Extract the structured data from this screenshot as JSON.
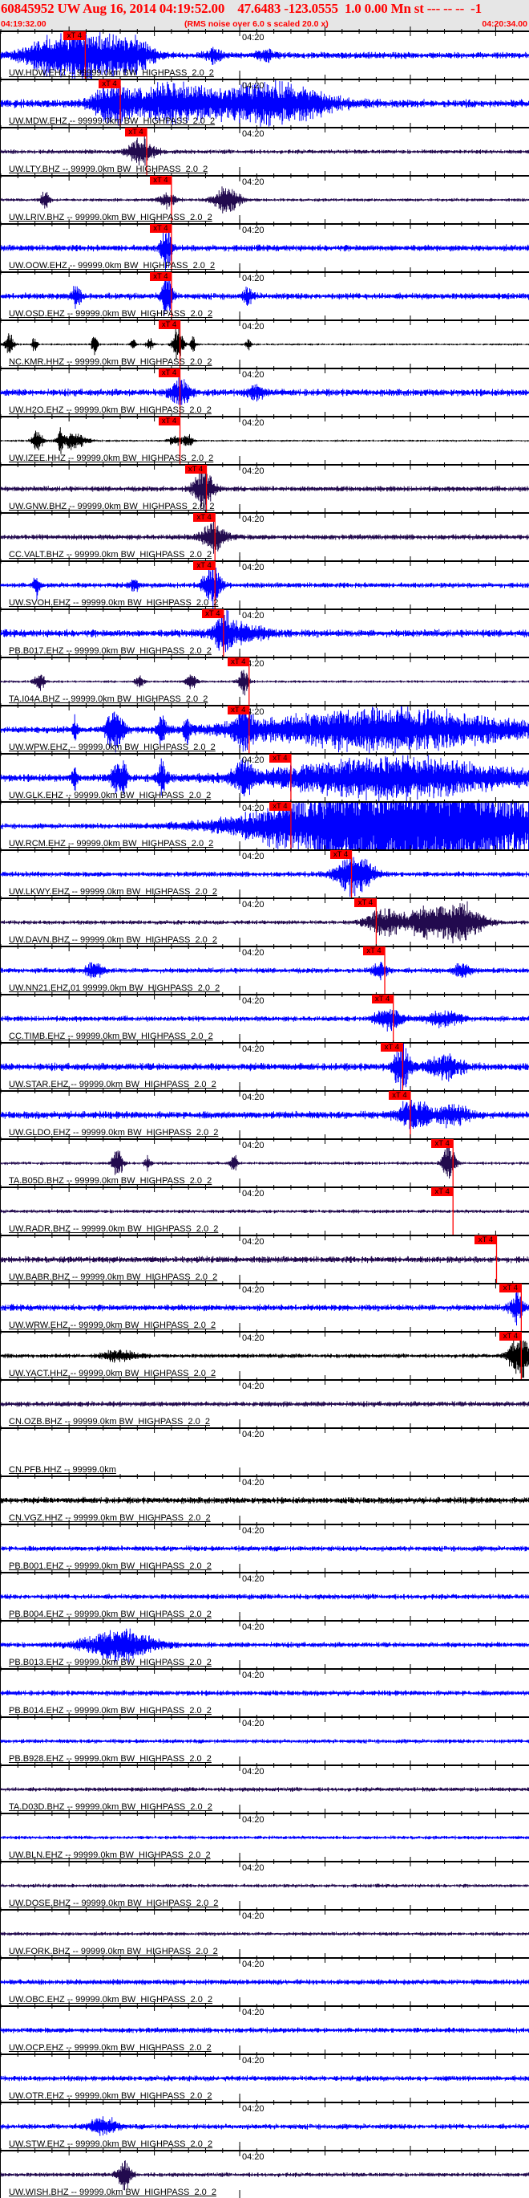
{
  "header": {
    "title": "60845952 UW Aug 16, 2014 04:19:52.00    47.6483 -123.0555  1.0 0.00 Mn st --- -- --  -1",
    "start_time": "04:19:32.00",
    "note": "(RMS noise over 6.0 s scaled 20.0 x)",
    "end_time": "04:20:34.00"
  },
  "axis": {
    "window_seconds": 62,
    "minute_mark_seconds": 28,
    "minute_label": "04:20"
  },
  "pick_label": "xT 4",
  "colors": {
    "ehz": "#0000ff",
    "bhz": "#220a4e",
    "hhz": "#000000",
    "pick": "#ff0000"
  },
  "traces": [
    {
      "label": "UW.HDW.EHZ -- 99999.0km BW  HIGHPASS  2.0  2",
      "c": "ehz",
      "n": 0.12,
      "pick": 9.9,
      "ev": [
        [
          7,
          0.9,
          4
        ],
        [
          12,
          0.8,
          3
        ],
        [
          16,
          0.7,
          2
        ],
        [
          25,
          0.3,
          1
        ],
        [
          31,
          0.25,
          1
        ]
      ]
    },
    {
      "label": "UW.MDW.EHZ -- 99999.0km BW  HIGHPASS  2.0  2",
      "c": "ehz",
      "n": 0.15,
      "pick": 14.0,
      "ev": [
        [
          13,
          0.7,
          2
        ],
        [
          20,
          0.8,
          6
        ],
        [
          32,
          0.9,
          6
        ]
      ]
    },
    {
      "label": "UW.LTY.BHZ -- 99999.0km BW  HIGHPASS  2.0  2",
      "c": "bhz",
      "n": 0.08,
      "pick": 17.1,
      "ev": [
        [
          16.5,
          0.6,
          1.5
        ]
      ]
    },
    {
      "label": "UW.LRIV.BHZ -- 99999.0km BW  HIGHPASS  2.0  2",
      "c": "bhz",
      "n": 0.06,
      "pick": 20.0,
      "ev": [
        [
          5.2,
          0.5,
          0.5
        ],
        [
          19.5,
          0.35,
          1
        ],
        [
          26.5,
          0.6,
          1.5
        ]
      ]
    },
    {
      "label": "UW.OOW.EHZ -- 99999.0km BW  HIGHPASS  2.0  2",
      "c": "ehz",
      "n": 0.12,
      "pick": 20.0,
      "ev": [
        [
          19.4,
          1.0,
          0.6
        ]
      ]
    },
    {
      "label": "UW.OSD.EHZ -- 99999.0km BW  HIGHPASS  2.0  2",
      "c": "ehz",
      "n": 0.12,
      "pick": 20.0,
      "ev": [
        [
          8.8,
          0.45,
          0.6
        ],
        [
          19.5,
          1.0,
          0.6
        ],
        [
          29,
          0.35,
          0.5
        ]
      ]
    },
    {
      "label": "NC.KMR.HHZ -- 99999.0km BW  HIGHPASS  2.0  2",
      "c": "hhz",
      "n": 0.04,
      "pick": 21.0,
      "ev": [
        [
          1,
          0.5,
          0.5
        ],
        [
          4,
          0.4,
          0.3
        ],
        [
          11,
          0.6,
          0.3
        ],
        [
          15.5,
          0.3,
          0.3
        ],
        [
          17.5,
          0.3,
          0.4
        ],
        [
          20.8,
          0.8,
          0.6
        ],
        [
          22.5,
          0.4,
          0.3
        ],
        [
          29,
          0.25,
          0.3
        ]
      ]
    },
    {
      "label": "UW.H2O.EHZ -- 99999.0km BW  HIGHPASS  2.0  2",
      "c": "ehz",
      "n": 0.13,
      "pick": 21.0,
      "ev": [
        [
          21,
          0.6,
          1.2
        ],
        [
          30,
          0.3,
          1
        ]
      ]
    },
    {
      "label": "UW.IZEE.HHZ -- 99999.0km BW  HIGHPASS  2.0  2",
      "c": "hhz",
      "n": 0.04,
      "pick": 21.0,
      "ev": [
        [
          4.3,
          0.5,
          0.6
        ],
        [
          7,
          0.6,
          0.3
        ],
        [
          8.5,
          0.4,
          1.5
        ],
        [
          20.5,
          0.25,
          0.8
        ],
        [
          22,
          0.3,
          0.5
        ]
      ]
    },
    {
      "label": "UW.GNW.BHZ -- 99999.0km BW  HIGHPASS  2.0  2",
      "c": "bhz",
      "n": 0.1,
      "pick": 24.1,
      "ev": [
        [
          23.8,
          0.9,
          1.2
        ]
      ]
    },
    {
      "label": "CC.VALT.BHZ -- 99999.0km BW  HIGHPASS  2.0  2",
      "c": "bhz",
      "n": 0.1,
      "pick": 25.1,
      "ev": [
        [
          25,
          0.6,
          1.5
        ]
      ]
    },
    {
      "label": "UW.SVOH.EHZ -- 99999.0km BW  HIGHPASS  2.0  2",
      "c": "ehz",
      "n": 0.1,
      "pick": 25.1,
      "ev": [
        [
          4.2,
          0.5,
          0.4
        ],
        [
          15.7,
          0.3,
          0.5
        ],
        [
          24.8,
          0.9,
          1
        ]
      ]
    },
    {
      "label": "PB.B017.EHZ -- 99999.0km BW  HIGHPASS  2.0  2",
      "c": "ehz",
      "n": 0.14,
      "pick": 26.1,
      "ev": [
        [
          26,
          0.9,
          0.8
        ],
        [
          28,
          0.4,
          3
        ]
      ]
    },
    {
      "label": "TA.I04A.BHZ -- 99999.0km BW  HIGHPASS  2.0  2",
      "c": "bhz",
      "n": 0.05,
      "pick": 29.1,
      "ev": [
        [
          4.5,
          0.5,
          0.6
        ],
        [
          16.3,
          0.3,
          0.5
        ],
        [
          22.3,
          0.35,
          0.6
        ],
        [
          28.5,
          0.5,
          0.6
        ]
      ]
    },
    {
      "label": "UW.WPW.EHZ -- 99999.0km BW  HIGHPASS  2.0  2",
      "c": "ehz",
      "n": 0.12,
      "pick": 29.1,
      "ev": [
        [
          8.7,
          0.6,
          0.3
        ],
        [
          12.8,
          0.7,
          0.5
        ],
        [
          13.7,
          0.9,
          0.8
        ],
        [
          18.9,
          0.6,
          0.5
        ],
        [
          21.8,
          0.6,
          0.3
        ],
        [
          28.5,
          0.8,
          1
        ],
        [
          45,
          0.9,
          16
        ]
      ]
    },
    {
      "label": "UW.GLK.EHZ -- 99999.0km BW  HIGHPASS  2.0  2",
      "c": "ehz",
      "n": 0.14,
      "pick": 34.0,
      "ev": [
        [
          8.7,
          0.8,
          0.3
        ],
        [
          13.7,
          0.7,
          0.8
        ],
        [
          14.5,
          0.6,
          0.3
        ],
        [
          18.9,
          0.7,
          0.5
        ],
        [
          28.5,
          0.8,
          1
        ],
        [
          46,
          0.9,
          14
        ]
      ]
    },
    {
      "label": "UW.RCM.EHZ -- 99999.0km BW  HIGHPASS  2.0  2",
      "c": "ehz",
      "n": 0.1,
      "pick": 34.0,
      "ev": [
        [
          48,
          2.5,
          15
        ]
      ]
    },
    {
      "label": "UW.LKWY.EHZ -- 99999.0km BW  HIGHPASS  2.0  2",
      "c": "ehz",
      "n": 0.1,
      "pick": 41.1,
      "ev": [
        [
          41.5,
          1.0,
          2
        ]
      ]
    },
    {
      "label": "UW.DAVN.BHZ -- 99999.0km BW  HIGHPASS  2.0  2",
      "c": "bhz",
      "n": 0.08,
      "pick": 44.0,
      "ev": [
        [
          45,
          0.6,
          2
        ],
        [
          50,
          0.7,
          2.5
        ],
        [
          54,
          0.8,
          2.5
        ]
      ]
    },
    {
      "label": "UW.NN21.EHZ.01 99999.0km BW  HIGHPASS  2.0  2",
      "c": "ehz",
      "n": 0.1,
      "pick": 45.0,
      "ev": [
        [
          11,
          0.35,
          1
        ],
        [
          44.5,
          0.45,
          0.8
        ],
        [
          54,
          0.3,
          1
        ]
      ]
    },
    {
      "label": "CC.TIMB.EHZ -- 99999.0km BW  HIGHPASS  2.0  2",
      "c": "ehz",
      "n": 0.1,
      "pick": 46.0,
      "ev": [
        [
          45.5,
          0.5,
          1.5
        ],
        [
          52,
          0.35,
          2
        ]
      ]
    },
    {
      "label": "UW.STAR.EHZ -- 99999.0km BW  HIGHPASS  2.0  2",
      "c": "ehz",
      "n": 0.14,
      "pick": 47.1,
      "ev": [
        [
          47,
          0.9,
          1
        ],
        [
          52,
          0.5,
          2
        ]
      ]
    },
    {
      "label": "UW.GLDO.EHZ -- 99999.0km BW  HIGHPASS  2.0  2",
      "c": "ehz",
      "n": 0.14,
      "pick": 48.0,
      "ev": [
        [
          48.5,
          0.6,
          2
        ],
        [
          53,
          0.4,
          2
        ]
      ]
    },
    {
      "label": "TA.B05D.BHZ -- 99999.0km BW  HIGHPASS  2.0  2",
      "c": "bhz",
      "n": 0.06,
      "pick": 53.0,
      "ev": [
        [
          13.7,
          0.6,
          0.6
        ],
        [
          17.2,
          0.3,
          0.4
        ],
        [
          27.3,
          0.4,
          0.4
        ],
        [
          52.5,
          0.9,
          0.7
        ]
      ]
    },
    {
      "label": "UW.RADR.BHZ -- 99999.0km BW  HIGHPASS  2.0  2",
      "c": "bhz",
      "n": 0.07,
      "pick": 53.0,
      "ev": []
    },
    {
      "label": "UW.BABR.BHZ -- 99999.0km BW  HIGHPASS  2.0  2",
      "c": "bhz",
      "n": 0.12,
      "pick": 58.1,
      "ev": []
    },
    {
      "label": "UW.WRW.EHZ -- 99999.0km BW  HIGHPASS  2.0  2",
      "c": "ehz",
      "n": 0.12,
      "pick": 61.0,
      "ev": [
        [
          60.5,
          0.7,
          0.8
        ]
      ]
    },
    {
      "label": "UW.YACT.HHZ -- 99999.0km BW  HIGHPASS  2.0  2",
      "c": "hhz",
      "n": 0.08,
      "pick": 61.0,
      "ev": [
        [
          14,
          0.25,
          2
        ],
        [
          60.8,
          1.0,
          1.2
        ]
      ]
    },
    {
      "label": "CN.OZB.BHZ -- 99999.0km BW  HIGHPASS  2.0  2",
      "c": "bhz",
      "n": 0.1,
      "pick": null,
      "ev": []
    },
    {
      "label": "CN.PFB.HHZ -- 99999.0km",
      "c": "hhz",
      "n": 0,
      "pick": null,
      "ev": []
    },
    {
      "label": "CN.VGZ.HHZ -- 99999.0km BW  HIGHPASS  2.0  2",
      "c": "hhz",
      "n": 0.12,
      "pick": null,
      "ev": []
    },
    {
      "label": "PB.B001.EHZ -- 99999.0km BW  HIGHPASS  2.0  2",
      "c": "ehz",
      "n": 0.1,
      "pick": null,
      "ev": []
    },
    {
      "label": "PB.B004.EHZ -- 99999.0km BW  HIGHPASS  2.0  2",
      "c": "ehz",
      "n": 0.1,
      "pick": null,
      "ev": []
    },
    {
      "label": "PB.B013.EHZ -- 99999.0km BW  HIGHPASS  2.0  2",
      "c": "ehz",
      "n": 0.1,
      "pick": null,
      "ev": [
        [
          14,
          0.7,
          4
        ]
      ]
    },
    {
      "label": "PB.B014.EHZ -- 99999.0km BW  HIGHPASS  2.0  2",
      "c": "ehz",
      "n": 0.1,
      "pick": null,
      "ev": []
    },
    {
      "label": "PB.B928.EHZ -- 99999.0km BW  HIGHPASS  2.0  2",
      "c": "ehz",
      "n": 0.08,
      "pick": null,
      "ev": []
    },
    {
      "label": "TA.D03D.BHZ -- 99999.0km BW  HIGHPASS  2.0  2",
      "c": "bhz",
      "n": 0.08,
      "pick": null,
      "ev": []
    },
    {
      "label": "UW.BLN.EHZ -- 99999.0km BW  HIGHPASS  2.0  2",
      "c": "ehz",
      "n": 0.07,
      "pick": null,
      "ev": []
    },
    {
      "label": "UW.DOSE.BHZ -- 99999.0km BW  HIGHPASS  2.0  2",
      "c": "bhz",
      "n": 0.07,
      "pick": null,
      "ev": []
    },
    {
      "label": "UW.FORK.BHZ -- 99999.0km BW  HIGHPASS  2.0  2",
      "c": "bhz",
      "n": 0.07,
      "pick": null,
      "ev": []
    },
    {
      "label": "UW.OBC.EHZ -- 99999.0km BW  HIGHPASS  2.0  2",
      "c": "ehz",
      "n": 0.1,
      "pick": null,
      "ev": []
    },
    {
      "label": "UW.OCP.EHZ -- 99999.0km BW  HIGHPASS  2.0  2",
      "c": "ehz",
      "n": 0.1,
      "pick": null,
      "ev": []
    },
    {
      "label": "UW.OTR.EHZ -- 99999.0km BW  HIGHPASS  2.0  2",
      "c": "ehz",
      "n": 0.1,
      "pick": null,
      "ev": []
    },
    {
      "label": "UW.STW.EHZ -- 99999.0km BW  HIGHPASS  2.0  2",
      "c": "ehz",
      "n": 0.1,
      "pick": null,
      "ev": [
        [
          12,
          0.4,
          1.5
        ]
      ]
    },
    {
      "label": "UW.WISH.BHZ -- 99999.0km BW  HIGHPASS  2.0  2",
      "c": "bhz",
      "n": 0.08,
      "pick": null,
      "ev": [
        [
          14.5,
          0.6,
          0.8
        ]
      ]
    }
  ]
}
